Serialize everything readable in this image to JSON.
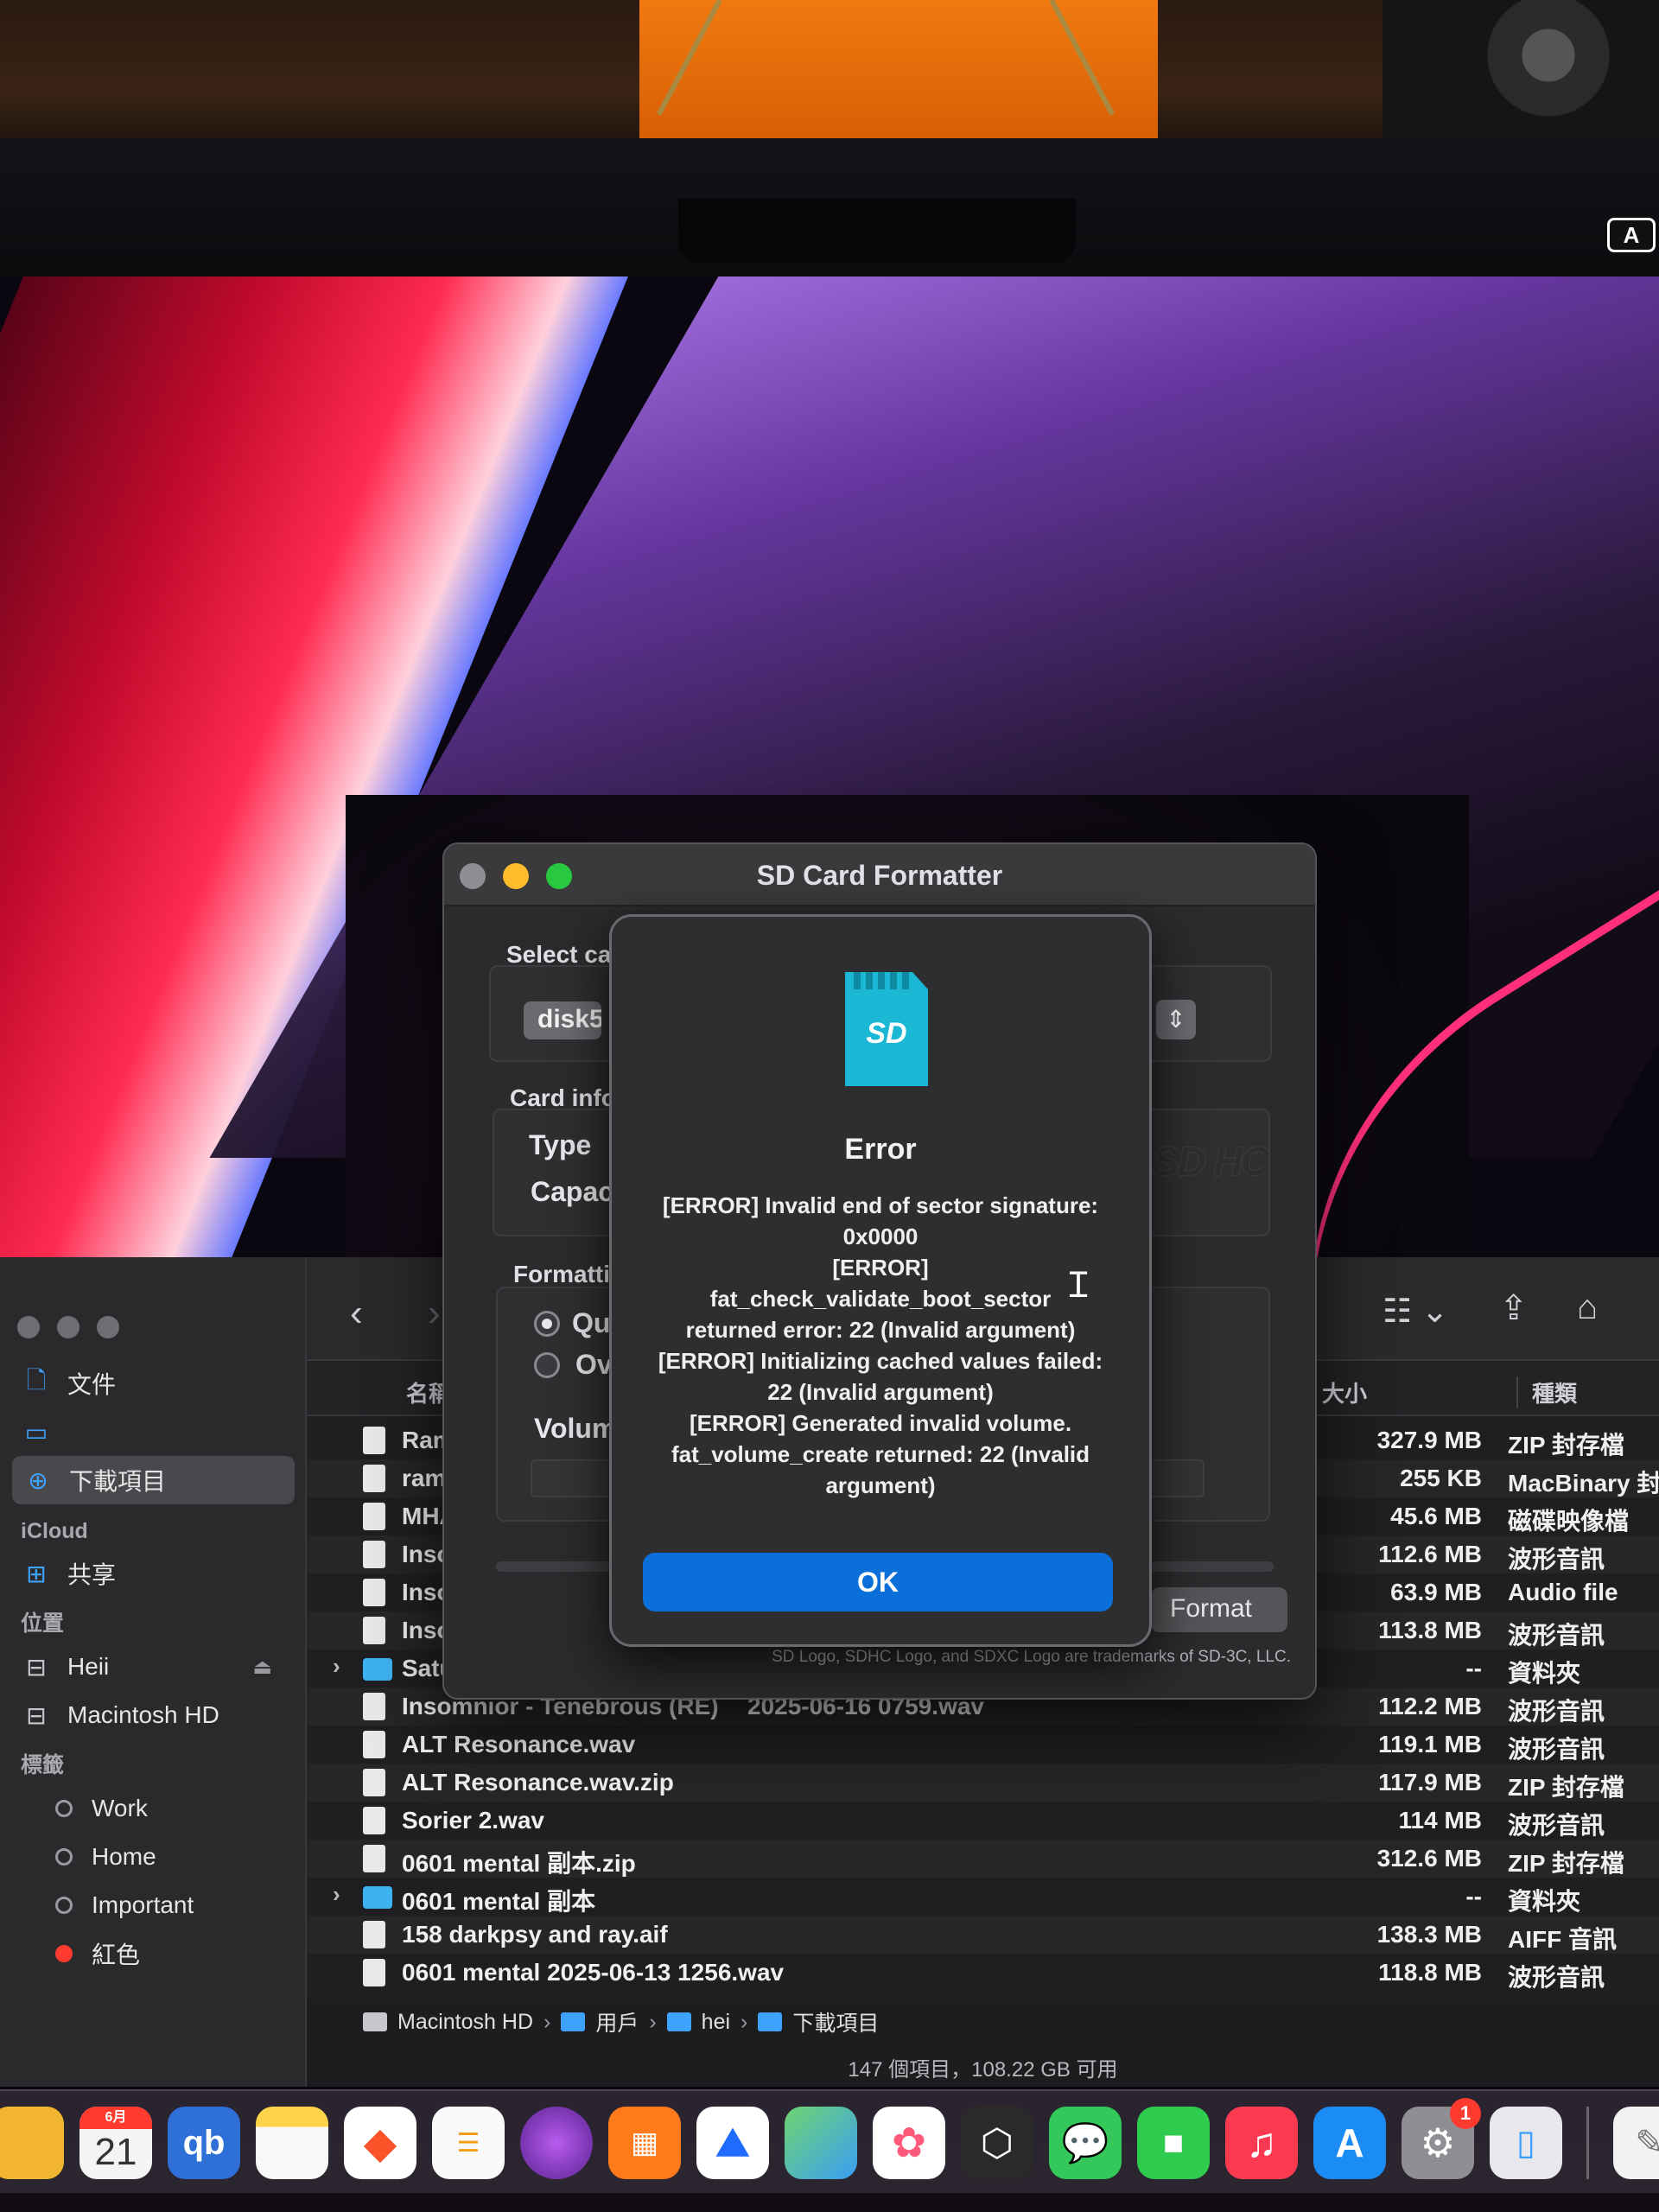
{
  "screen": {
    "input_indicator": "A"
  },
  "finder": {
    "sidebar": {
      "top_items": [
        {
          "icon": "document-icon",
          "label": "文件"
        },
        {
          "icon": "folder-icon",
          "label": ""
        },
        {
          "icon": "download-icon",
          "label": "下載項目",
          "selected": true
        }
      ],
      "icloud_header": "iCloud",
      "icloud_items": [
        {
          "icon": "shared-folder-icon",
          "label": "共享"
        }
      ],
      "locations_header": "位置",
      "locations": [
        {
          "icon": "drive-icon",
          "label": "Heii",
          "eject": true
        },
        {
          "icon": "drive-icon",
          "label": "Macintosh HD",
          "eject": false
        }
      ],
      "tags_header": "標籤",
      "tags": [
        {
          "label": "Work",
          "color": "#9a9aa0"
        },
        {
          "label": "Home",
          "color": "#9a9aa0"
        },
        {
          "label": "Important",
          "color": "#9a9aa0"
        },
        {
          "label": "紅色",
          "color": "#ff3b30"
        }
      ]
    },
    "columns": {
      "name": "名稱",
      "size": "大小",
      "kind": "種類"
    },
    "rows": [
      {
        "name": "Ram",
        "date": "",
        "size": "327.9 MB",
        "kind": "ZIP 封存檔",
        "folder": false,
        "expandable": false
      },
      {
        "name": "ram",
        "date": "",
        "size": "255 KB",
        "kind": "MacBinary 封",
        "folder": false,
        "expandable": false
      },
      {
        "name": "MHA",
        "date": "",
        "size": "45.6 MB",
        "kind": "磁碟映像檔",
        "folder": false,
        "expandable": false
      },
      {
        "name": "Inso",
        "date": "",
        "size": "112.6 MB",
        "kind": "波形音訊",
        "folder": false,
        "expandable": false
      },
      {
        "name": "Inso",
        "date": "",
        "size": "63.9 MB",
        "kind": "Audio file",
        "folder": false,
        "expandable": false
      },
      {
        "name": "Inso",
        "date": "",
        "size": "113.8 MB",
        "kind": "波形音訊",
        "folder": false,
        "expandable": false
      },
      {
        "name": "Satu",
        "date": "",
        "size": "--",
        "kind": "資料夾",
        "folder": true,
        "expandable": true
      },
      {
        "name": "Insomnior - Tenebrous (RE)",
        "date": "2025-06-16 0759.wav",
        "size": "112.2 MB",
        "kind": "波形音訊",
        "folder": false,
        "expandable": false
      },
      {
        "name": "ALT Resonance.wav",
        "date": "",
        "size": "119.1 MB",
        "kind": "波形音訊",
        "folder": false,
        "expandable": false
      },
      {
        "name": "ALT Resonance.wav.zip",
        "date": "",
        "size": "117.9 MB",
        "kind": "ZIP 封存檔",
        "folder": false,
        "expandable": false
      },
      {
        "name": "Sorier  2.wav",
        "date": "",
        "size": "114 MB",
        "kind": "波形音訊",
        "folder": false,
        "expandable": false
      },
      {
        "name": "0601 mental 副本.zip",
        "date": "",
        "size": "312.6 MB",
        "kind": "ZIP 封存檔",
        "folder": false,
        "expandable": false
      },
      {
        "name": "0601 mental 副本",
        "date": "",
        "size": "--",
        "kind": "資料夾",
        "folder": true,
        "expandable": true
      },
      {
        "name": "158 darkpsy and ray.aif",
        "date": "",
        "size": "138.3 MB",
        "kind": "AIFF 音訊",
        "folder": false,
        "expandable": false
      },
      {
        "name": "0601 mental 2025-06-13 1256.wav",
        "date": "",
        "size": "118.8 MB",
        "kind": "波形音訊",
        "folder": false,
        "expandable": false
      }
    ],
    "path": [
      {
        "label": "Macintosh HD",
        "icon": "drive-icon"
      },
      {
        "label": "用戶",
        "icon": "folder-icon"
      },
      {
        "label": "hei",
        "icon": "home-folder-icon"
      },
      {
        "label": "下載項目",
        "icon": "download-folder-icon"
      }
    ],
    "status": "147 個項目，108.22 GB 可用"
  },
  "sd_formatter": {
    "title": "SD Card Formatter",
    "select_card_label": "Select ca",
    "selected_card": "disk5",
    "card_info_label": "Card info",
    "type_label": "Type",
    "capacity_label": "Capaci",
    "formatting_label": "Formattin",
    "quick_label": "Qui",
    "overwrite_label": "Ove",
    "volume_label": "Volume",
    "format_button": "Format",
    "trademark": "SD Logo, SDHC Logo, and SDXC Logo are trademarks of SD-3C, LLC.",
    "sdhc_logo": "SD HC"
  },
  "alert": {
    "icon_text": "SD",
    "title": "Error",
    "message_lines": [
      "[ERROR] Invalid end of sector signature:",
      "0x0000",
      "[ERROR]",
      "fat_check_validate_boot_sector",
      "returned error: 22 (Invalid argument)",
      "[ERROR] Initializing cached values failed:",
      "22 (Invalid argument)",
      "[ERROR] Generated invalid volume.",
      "fat_volume_create returned: 22 (Invalid",
      "argument)"
    ],
    "ok_button": "OK",
    "accent": "#0a6fd8"
  },
  "dock": {
    "calendar_month": "6月",
    "calendar_day": "21",
    "qbittorrent": "qb",
    "settings_badge": "1"
  }
}
